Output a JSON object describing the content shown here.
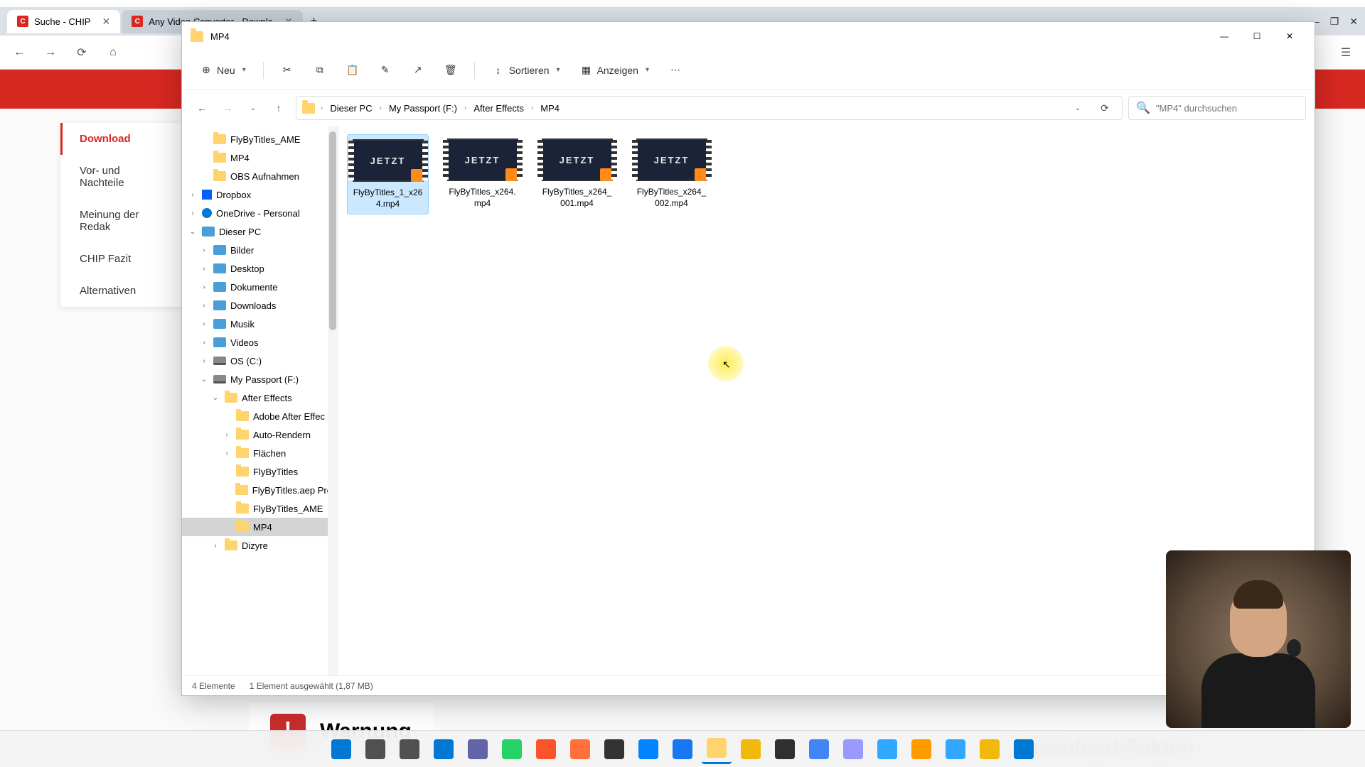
{
  "browser": {
    "tabs": [
      {
        "label": "Suche - CHIP",
        "favicon": "C"
      },
      {
        "label": "Any Video Converter - Downlo",
        "favicon": "C"
      }
    ],
    "controls": {
      "minimize": "—",
      "maximize": "❐",
      "close": "✕"
    }
  },
  "bg_page": {
    "sidebar": [
      "Download",
      "Vor- und Nachteile",
      "Meinung der Redak",
      "CHIP Fazit",
      "Alternativen"
    ],
    "warning_label": "Warnung",
    "download_facts": "Download-Fakten:"
  },
  "explorer": {
    "title": "MP4",
    "win_controls": {
      "minimize": "—",
      "maximize": "☐",
      "close": "✕"
    },
    "toolbar": {
      "new": "Neu",
      "sort": "Sortieren",
      "view": "Anzeigen"
    },
    "breadcrumbs": [
      "Dieser PC",
      "My Passport (F:)",
      "After Effects",
      "MP4"
    ],
    "search_placeholder": "\"MP4\" durchsuchen",
    "tree": [
      {
        "label": "FlyByTitles_AME",
        "indent": 1,
        "icon": "folder"
      },
      {
        "label": "MP4",
        "indent": 1,
        "icon": "folder"
      },
      {
        "label": "OBS Aufnahmen",
        "indent": 1,
        "icon": "folder"
      },
      {
        "label": "Dropbox",
        "indent": 0,
        "icon": "dropbox",
        "expand": ">"
      },
      {
        "label": "OneDrive - Personal",
        "indent": 0,
        "icon": "cloud",
        "expand": ">"
      },
      {
        "label": "Dieser PC",
        "indent": 0,
        "icon": "pc",
        "expand": "v"
      },
      {
        "label": "Bilder",
        "indent": 1,
        "icon": "lib",
        "expand": ">"
      },
      {
        "label": "Desktop",
        "indent": 1,
        "icon": "lib",
        "expand": ">"
      },
      {
        "label": "Dokumente",
        "indent": 1,
        "icon": "lib",
        "expand": ">"
      },
      {
        "label": "Downloads",
        "indent": 1,
        "icon": "lib",
        "expand": ">"
      },
      {
        "label": "Musik",
        "indent": 1,
        "icon": "lib",
        "expand": ">"
      },
      {
        "label": "Videos",
        "indent": 1,
        "icon": "lib",
        "expand": ">"
      },
      {
        "label": "OS (C:)",
        "indent": 1,
        "icon": "drive",
        "expand": ">"
      },
      {
        "label": "My Passport (F:)",
        "indent": 1,
        "icon": "drive",
        "expand": "v"
      },
      {
        "label": "After Effects",
        "indent": 2,
        "icon": "folder",
        "expand": "v"
      },
      {
        "label": "Adobe After Effec",
        "indent": 3,
        "icon": "folder"
      },
      {
        "label": "Auto-Rendern",
        "indent": 3,
        "icon": "folder",
        "expand": ">"
      },
      {
        "label": "Flächen",
        "indent": 3,
        "icon": "folder",
        "expand": ">"
      },
      {
        "label": "FlyByTitles",
        "indent": 3,
        "icon": "folder"
      },
      {
        "label": "FlyByTitles.aep Pro",
        "indent": 3,
        "icon": "folder"
      },
      {
        "label": "FlyByTitles_AME",
        "indent": 3,
        "icon": "folder"
      },
      {
        "label": "MP4",
        "indent": 3,
        "icon": "folder",
        "selected": true
      },
      {
        "label": "Dizyre",
        "indent": 2,
        "icon": "folder",
        "expand": ">"
      }
    ],
    "files": [
      {
        "name": "FlyByTitles_1_x264.mp4",
        "thumb_text": "JETZT",
        "selected": true
      },
      {
        "name": "FlyByTitles_x264.mp4",
        "thumb_text": "JETZT"
      },
      {
        "name": "FlyByTitles_x264_001.mp4",
        "thumb_text": "JETZT"
      },
      {
        "name": "FlyByTitles_x264_002.mp4",
        "thumb_text": "JETZT"
      }
    ],
    "status": {
      "count": "4 Elemente",
      "selection": "1 Element ausgewählt (1,87 MB)"
    }
  },
  "taskbar_icons": [
    "start",
    "search",
    "taskview",
    "widgets",
    "teams",
    "whatsapp",
    "brave",
    "firefox",
    "person",
    "messenger",
    "facebook",
    "explorer",
    "money",
    "obs",
    "video",
    "afterfx",
    "photoshop",
    "illustrator",
    "lightroom",
    "wallet",
    "edge"
  ],
  "icon_colors": {
    "start": "#0078d4",
    "search": "#505050",
    "taskview": "#505050",
    "widgets": "#0078d4",
    "teams": "#6264a7",
    "whatsapp": "#25d366",
    "brave": "#fb542b",
    "firefox": "#ff7139",
    "person": "#333333",
    "messenger": "#0084ff",
    "facebook": "#1877f2",
    "explorer": "#ffd36e",
    "money": "#f0b90b",
    "obs": "#302e31",
    "video": "#4285f4",
    "afterfx": "#9999ff",
    "photoshop": "#31a8ff",
    "illustrator": "#ff9a00",
    "lightroom": "#31a8ff",
    "wallet": "#f0b90b",
    "edge": "#0078d4"
  }
}
